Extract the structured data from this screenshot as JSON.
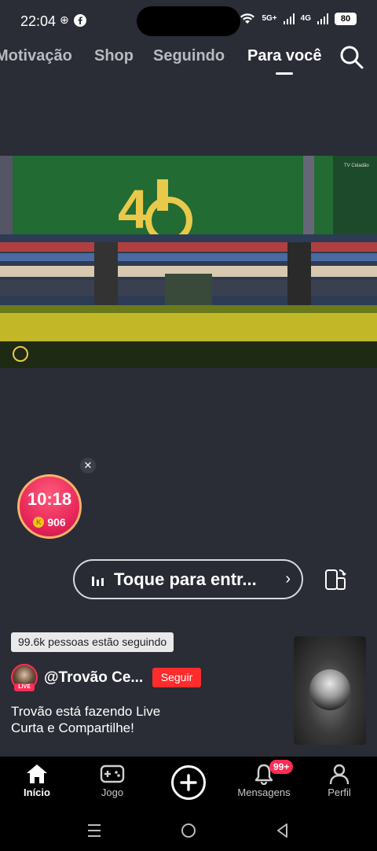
{
  "status_bar": {
    "time": "22:04",
    "network_5g": "5G+",
    "network_4g": "4G",
    "battery": "80"
  },
  "top_tabs": [
    {
      "label": "Motivação",
      "active": false
    },
    {
      "label": "Shop",
      "active": false
    },
    {
      "label": "Seguindo",
      "active": false
    },
    {
      "label": "Para você",
      "active": true
    }
  ],
  "video": {
    "overlay_text": "TV Cidadão"
  },
  "timer_widget": {
    "time": "10:18",
    "coin_symbol": "K",
    "coins": "906"
  },
  "live_pill": {
    "label": "Toque para entr..."
  },
  "followers_badge": "99.6k pessoas estão seguindo",
  "host": {
    "name": "@Trovão Ce...",
    "live_label": "LIVE",
    "follow_label": "Seguir",
    "caption_line1": "Trovão está fazendo Live",
    "caption_line2": "Curta e Compartilhe!"
  },
  "bottom_nav": {
    "home": "Início",
    "games": "Jogo",
    "messages": "Mensagens",
    "messages_badge": "99+",
    "profile": "Perfil"
  },
  "colors": {
    "background": "#2a2c36",
    "follow_button": "#fe2c2c",
    "badge": "#fe2c55"
  }
}
